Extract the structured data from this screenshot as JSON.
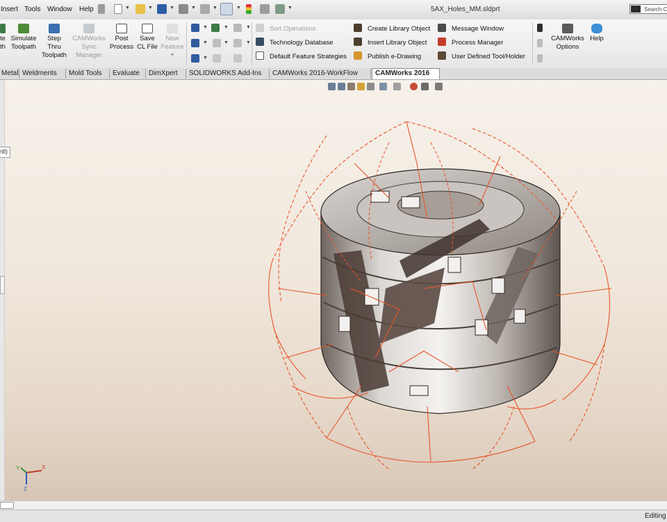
{
  "title_bar": {
    "menus": [
      "Insert",
      "Tools",
      "Window",
      "Help"
    ],
    "document_title": "5AX_Holes_MM.sldprt",
    "search_placeholder": "Search Co"
  },
  "ribbon": {
    "big_buttons": [
      {
        "label_lines": [
          "te",
          "th"
        ],
        "enabled": true
      },
      {
        "label_lines": [
          "Simulate",
          "Toolpath"
        ],
        "enabled": true
      },
      {
        "label_lines": [
          "Step",
          "Thru",
          "Toolpath"
        ],
        "enabled": true
      },
      {
        "label_lines": [
          "CAMWorks",
          "Sync",
          "Manager"
        ],
        "enabled": false
      },
      {
        "label_lines": [
          "Post",
          "Process"
        ],
        "enabled": true
      },
      {
        "label_lines": [
          "Save",
          "CL File"
        ],
        "enabled": true
      },
      {
        "label_lines": [
          "New",
          "Feature"
        ],
        "enabled": false
      }
    ],
    "col1": [
      {
        "label": "Sort Operations",
        "enabled": false
      },
      {
        "label": "Technology Database",
        "enabled": true
      },
      {
        "label": "Default Feature Strategies",
        "enabled": true
      }
    ],
    "col2": [
      {
        "label": "Create Library Object",
        "enabled": true
      },
      {
        "label": "Insert Library Object",
        "enabled": true
      },
      {
        "label": "Publish e-Drawing",
        "enabled": true
      }
    ],
    "col3": [
      {
        "label": "Message Window",
        "enabled": true
      },
      {
        "label": "Process Manager",
        "enabled": true
      },
      {
        "label": "User Defined Tool/Holder",
        "enabled": true
      }
    ],
    "right_buttons": [
      {
        "label_lines": [
          "CAMWorks",
          "Options"
        ]
      },
      {
        "label_lines": [
          "Help"
        ]
      }
    ]
  },
  "tabs": [
    {
      "label": "Metal",
      "active": false
    },
    {
      "label": "Weldments",
      "active": false
    },
    {
      "label": "Mold Tools",
      "active": false
    },
    {
      "label": "Evaluate",
      "active": false
    },
    {
      "label": "DimXpert",
      "active": false
    },
    {
      "label": "SOLIDWORKS Add-Ins",
      "active": false
    },
    {
      "label": "CAMWorks 2016-WorkFlow",
      "active": false
    },
    {
      "label": "CAMWorks 2016",
      "active": true
    }
  ],
  "viewport": {
    "callout_text": "rill)",
    "triad_axes": [
      "Y",
      "X",
      "Z"
    ],
    "model_description_colors": {
      "toolpath": "#e8552a",
      "body": "#bdbdbd",
      "dark": "#4a3b34"
    }
  },
  "status_bar": {
    "text": "Editing"
  }
}
